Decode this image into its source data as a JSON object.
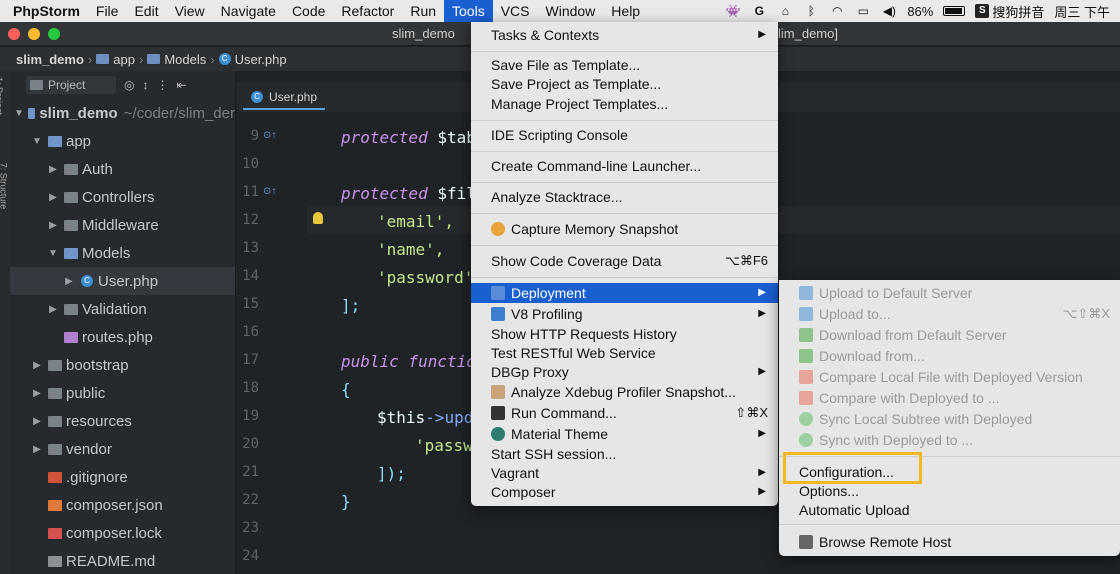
{
  "menubar": {
    "app_name": "PhpStorm",
    "items": [
      "File",
      "Edit",
      "View",
      "Navigate",
      "Code",
      "Refactor",
      "Run",
      "Tools",
      "VCS",
      "Window",
      "Help"
    ],
    "active_item": "Tools",
    "battery": "86%",
    "input_method": "搜狗拼音",
    "clock": "周三 下午"
  },
  "window": {
    "title_left": "slim_demo",
    "title_right": "lim_demo]"
  },
  "breadcrumb": [
    "slim_demo",
    "app",
    "Models",
    "User.php"
  ],
  "project_panel": {
    "selector_label": "Project",
    "tree": [
      {
        "label": "slim_demo",
        "note": "~/coder/slim_der",
        "depth": 0,
        "expanded": true,
        "kind": "module"
      },
      {
        "label": "app",
        "depth": 1,
        "expanded": true,
        "kind": "folder"
      },
      {
        "label": "Auth",
        "depth": 2,
        "expanded": false,
        "kind": "folder"
      },
      {
        "label": "Controllers",
        "depth": 2,
        "expanded": false,
        "kind": "folder"
      },
      {
        "label": "Middleware",
        "depth": 2,
        "expanded": false,
        "kind": "folder"
      },
      {
        "label": "Models",
        "depth": 2,
        "expanded": true,
        "kind": "folder"
      },
      {
        "label": "User.php",
        "depth": 3,
        "expanded": false,
        "kind": "php",
        "selected": true
      },
      {
        "label": "Validation",
        "depth": 2,
        "expanded": false,
        "kind": "folder"
      },
      {
        "label": "routes.php",
        "depth": 2,
        "kind": "php-routes"
      },
      {
        "label": "bootstrap",
        "depth": 1,
        "expanded": false,
        "kind": "folder"
      },
      {
        "label": "public",
        "depth": 1,
        "expanded": false,
        "kind": "folder"
      },
      {
        "label": "resources",
        "depth": 1,
        "expanded": false,
        "kind": "folder"
      },
      {
        "label": "vendor",
        "depth": 1,
        "expanded": false,
        "kind": "folder"
      },
      {
        "label": ".gitignore",
        "depth": 1,
        "kind": "git"
      },
      {
        "label": "composer.json",
        "depth": 1,
        "kind": "composer"
      },
      {
        "label": "composer.lock",
        "depth": 1,
        "kind": "lock"
      },
      {
        "label": "README.md",
        "depth": 1,
        "kind": "md"
      }
    ]
  },
  "editor": {
    "tab_label": "User.php",
    "line_numbers": [
      "9",
      "10",
      "11",
      "12",
      "13",
      "14",
      "15",
      "16",
      "17",
      "18",
      "19",
      "20",
      "21",
      "22",
      "23",
      "24"
    ],
    "lines": {
      "l9_kw": "protected",
      "l9_var": " $tabl",
      "l11_kw": "protected",
      "l11_var": " $fill",
      "l12": "'email',",
      "l13": "'name',",
      "l14": "'password'",
      "l15": "];",
      "l17_kw": "public",
      "l17_fn": " function",
      "l18": "{",
      "l19_var": "$this",
      "l19_rest": "->upda",
      "l20": "'passwo",
      "l21": "]);",
      "l22": "}"
    }
  },
  "tools_menu": {
    "items": [
      {
        "label": "Tasks & Contexts",
        "submenu": true
      },
      {
        "label": "Save File as Template..."
      },
      {
        "label": "Save Project as Template..."
      },
      {
        "label": "Manage Project Templates..."
      },
      {
        "label": "IDE Scripting Console"
      },
      {
        "label": "Create Command-line Launcher..."
      },
      {
        "label": "Analyze Stacktrace..."
      },
      {
        "label": "Capture Memory Snapshot",
        "icon": "memory-icon"
      },
      {
        "label": "Show Code Coverage Data",
        "shortcut": "⌥⌘F6"
      },
      {
        "label": "Deployment",
        "submenu": true,
        "selected": true,
        "icon": "deployment-icon"
      },
      {
        "label": "V8 Profiling",
        "submenu": true,
        "icon": "v8-icon"
      },
      {
        "label": "Show HTTP Requests History"
      },
      {
        "label": "Test RESTful Web Service"
      },
      {
        "label": "DBGp Proxy",
        "submenu": true
      },
      {
        "label": "Analyze Xdebug Profiler Snapshot...",
        "icon": "xdebug-icon"
      },
      {
        "label": "Run Command...",
        "shortcut": "⇧⌘X",
        "icon": "terminal-icon"
      },
      {
        "label": "Material Theme",
        "submenu": true,
        "icon": "material-icon"
      },
      {
        "label": "Start SSH session..."
      },
      {
        "label": "Vagrant",
        "submenu": true
      },
      {
        "label": "Composer",
        "submenu": true
      }
    ]
  },
  "deployment_submenu": {
    "items": [
      {
        "label": "Upload to Default Server",
        "disabled": true
      },
      {
        "label": "Upload to...",
        "shortcut": "⌥⇧⌘X",
        "disabled": true
      },
      {
        "label": "Download from Default Server",
        "disabled": true
      },
      {
        "label": "Download from...",
        "disabled": true
      },
      {
        "label": "Compare Local File with Deployed Version",
        "disabled": true
      },
      {
        "label": "Compare with Deployed to ...",
        "disabled": true
      },
      {
        "label": "Sync Local Subtree with Deployed",
        "disabled": true
      },
      {
        "label": "Sync with Deployed to ...",
        "disabled": true
      },
      {
        "label": "Configuration...",
        "highlighted": true
      },
      {
        "label": "Options..."
      },
      {
        "label": "Automatic Upload"
      },
      {
        "label": "Browse Remote Host",
        "icon": "server-icon"
      }
    ]
  },
  "colors": {
    "menu_select": "#1a5fd0",
    "highlight_box": "#f2b723",
    "keyword": "#c792ea",
    "string": "#c3e88d"
  }
}
